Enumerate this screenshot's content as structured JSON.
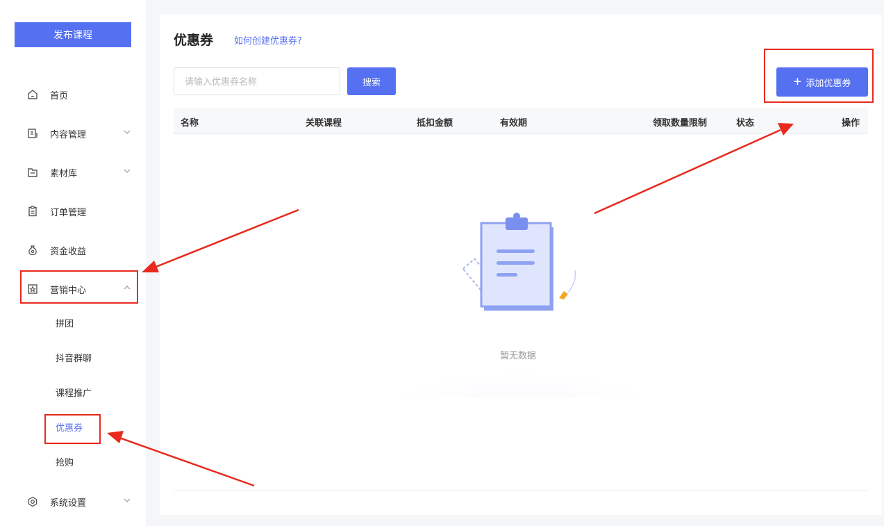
{
  "sidebar": {
    "publish_label": "发布课程",
    "items": [
      {
        "label": "首页",
        "icon": "home-icon"
      },
      {
        "label": "内容管理",
        "icon": "content-icon",
        "chevron": "down"
      },
      {
        "label": "素材库",
        "icon": "folder-icon",
        "chevron": "down"
      },
      {
        "label": "订单管理",
        "icon": "clipboard-icon"
      },
      {
        "label": "资金收益",
        "icon": "money-bag-icon"
      },
      {
        "label": "营销中心",
        "icon": "star-badge-icon",
        "chevron": "up"
      },
      {
        "label": "系统设置",
        "icon": "gear-icon",
        "chevron": "down"
      }
    ],
    "sub_items": [
      "拼团",
      "抖音群聊",
      "课程推广",
      "优惠券",
      "抢购"
    ],
    "active_sub": "优惠券"
  },
  "main": {
    "title": "优惠券",
    "help_link": "如何创建优惠券?",
    "search": {
      "placeholder": "请输入优惠券名称",
      "value": ""
    },
    "search_label": "搜索",
    "add_label": "添加优惠券",
    "columns": [
      "名称",
      "关联课程",
      "抵扣金额",
      "有效期",
      "领取数量限制",
      "状态",
      "操作"
    ],
    "rows": [],
    "empty_text": "暂无数据"
  },
  "colors": {
    "accent": "#5570f1",
    "annotation": "#e8291c"
  }
}
